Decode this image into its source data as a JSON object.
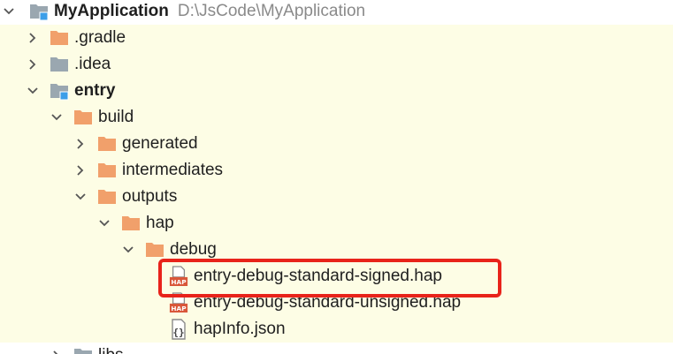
{
  "tree": {
    "root": {
      "name": "MyApplication",
      "path": "D:\\JsCode\\MyApplication",
      "icon": "module-folder-icon",
      "expanded": true
    },
    "items": [
      {
        "label": ".gradle",
        "icon": "folder-orange-icon",
        "expanded": false
      },
      {
        "label": ".idea",
        "icon": "folder-gray-icon",
        "expanded": false
      },
      {
        "label": "entry",
        "icon": "module-folder-icon",
        "expanded": true
      },
      {
        "label": "build",
        "icon": "folder-orange-icon",
        "expanded": true
      },
      {
        "label": "generated",
        "icon": "folder-orange-icon",
        "expanded": false
      },
      {
        "label": "intermediates",
        "icon": "folder-orange-icon",
        "expanded": false
      },
      {
        "label": "outputs",
        "icon": "folder-orange-icon",
        "expanded": true
      },
      {
        "label": "hap",
        "icon": "folder-orange-icon",
        "expanded": true
      },
      {
        "label": "debug",
        "icon": "folder-orange-icon",
        "expanded": true
      },
      {
        "label": "entry-debug-standard-signed.hap",
        "icon": "hap-file-icon",
        "highlighted": true
      },
      {
        "label": "entry-debug-standard-unsigned.hap",
        "icon": "hap-file-icon"
      },
      {
        "label": "hapInfo.json",
        "icon": "json-file-icon"
      },
      {
        "label": "libs",
        "icon": "folder-gray-icon",
        "expanded": false
      }
    ],
    "hap_badge": "HAP",
    "json_badge": "{}"
  },
  "colors": {
    "row_tint": "#fdfde5",
    "folder_orange": "#f1a06b",
    "folder_gray": "#9aa7b0",
    "module_blue": "#3c9ee8",
    "highlight_border": "#e8231a",
    "hap_badge": "#d9573a"
  }
}
